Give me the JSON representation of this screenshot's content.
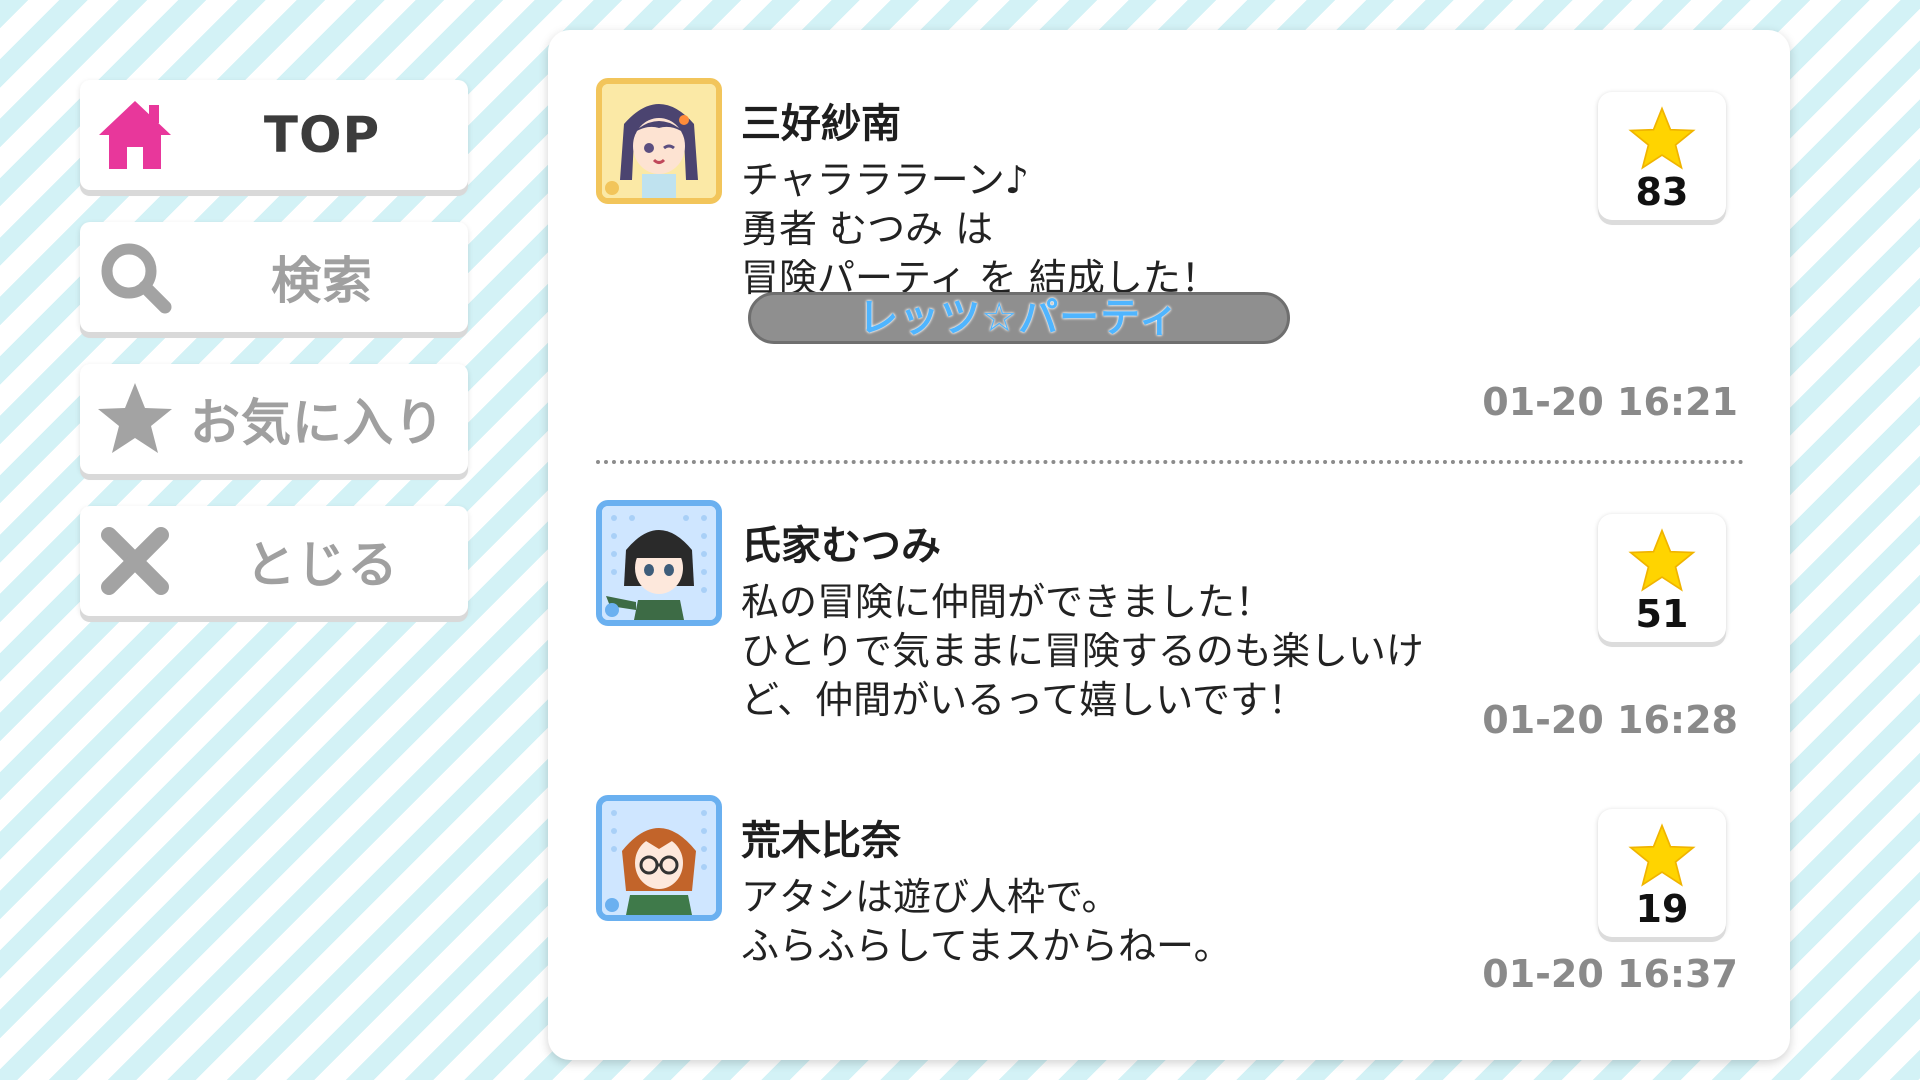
{
  "sidebar": {
    "items": [
      {
        "label": "TOP",
        "icon": "home-icon",
        "color": "#e8379b",
        "active": true
      },
      {
        "label": "検索",
        "icon": "search-icon",
        "active": false
      },
      {
        "label": "お気に入り",
        "icon": "star-icon",
        "active": false
      },
      {
        "label": "とじる",
        "icon": "close-icon",
        "active": false
      }
    ]
  },
  "posts": [
    {
      "name": "三好紗南",
      "avatar": "character-avatar-sana",
      "text": "チャラララーン♪\n勇者 むつみ は\n冒険パーティ を 結成した！",
      "tag": "レッツ☆パーティ",
      "likes": "83",
      "time": "01-20 16:21"
    },
    {
      "name": "氏家むつみ",
      "avatar": "character-avatar-mutsumi",
      "text": "私の冒険に仲間ができました！\nひとりで気ままに冒険するのも楽しいけ\nど、仲間がいるって嬉しいです！",
      "likes": "51",
      "time": "01-20 16:28"
    },
    {
      "name": "荒木比奈",
      "avatar": "character-avatar-hina",
      "text": "アタシは遊び人枠で。\nふらふらしてまスからねー。",
      "likes": "19",
      "time": "01-20 16:37"
    }
  ],
  "colors": {
    "accent_pink": "#e8379b",
    "star_yellow": "#ffd400",
    "tag_text": "#4fb5ff",
    "background_stripe": "#d3f2f6"
  }
}
